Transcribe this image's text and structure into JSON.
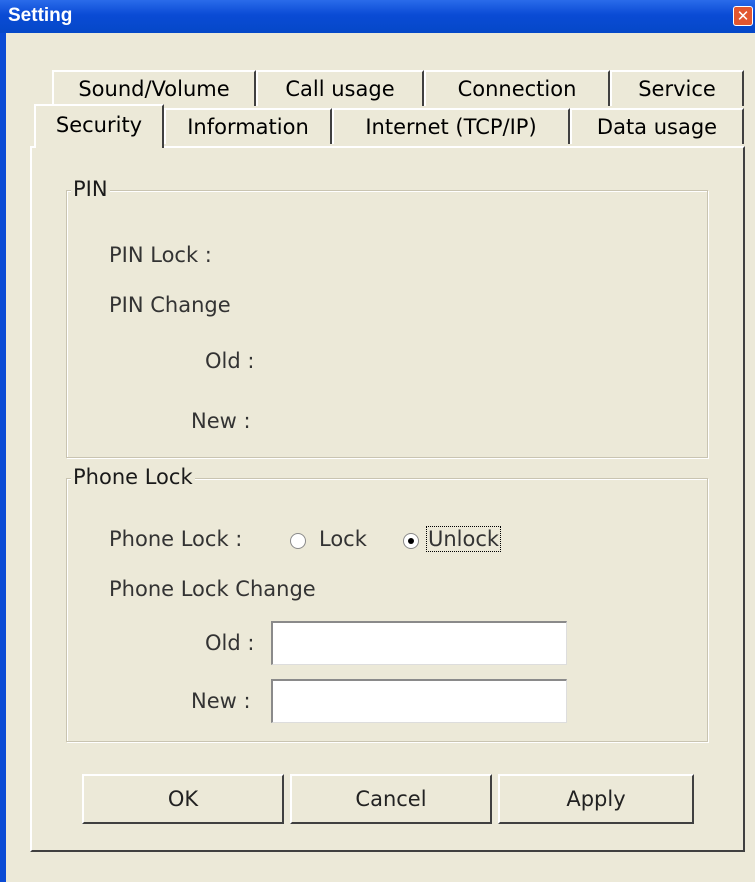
{
  "window": {
    "title": "Setting"
  },
  "tabs": {
    "row1": [
      "Sound/Volume",
      "Call usage",
      "Connection",
      "Service"
    ],
    "row2": [
      "Security",
      "Information",
      "Internet (TCP/IP)",
      "Data usage"
    ],
    "active": "Security"
  },
  "pin": {
    "group_title": "PIN",
    "lock_label": "PIN Lock :",
    "change_label": "PIN Change",
    "old_label": "Old :",
    "new_label": "New :"
  },
  "phone_lock": {
    "group_title": "Phone Lock",
    "lock_label": "Phone Lock :",
    "option_lock": "Lock",
    "option_unlock": "Unlock",
    "selected": "Unlock",
    "change_label": "Phone Lock Change",
    "old_label": "Old :",
    "new_label": "New :",
    "old_value": "",
    "new_value": ""
  },
  "buttons": {
    "ok": "OK",
    "cancel": "Cancel",
    "apply": "Apply"
  },
  "colors": {
    "titlebar": "#0A4BD5",
    "face": "#ECE9D8"
  }
}
